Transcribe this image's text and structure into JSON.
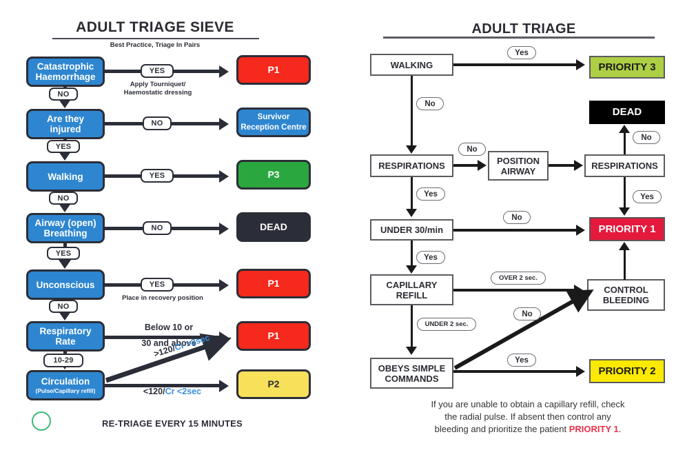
{
  "left_panel": {
    "title": "ADULT TRIAGE SIEVE",
    "subtitle": "Best Practice, Triage In Pairs",
    "questions": [
      {
        "label": "Catastrophic",
        "label2": "Haemorrhage",
        "sub": ""
      },
      {
        "label": "Are they",
        "label2": "injured",
        "sub": ""
      },
      {
        "label": "Walking",
        "label2": "",
        "sub": ""
      },
      {
        "label": "Airway (open)",
        "label2": "Breathing",
        "sub": ""
      },
      {
        "label": "Unconscious",
        "label2": "",
        "sub": ""
      },
      {
        "label": "Respiratory",
        "label2": "Rate",
        "sub": ""
      },
      {
        "label": "Circulation",
        "label2": "",
        "sub": "(Pulse/Capillary refill)"
      }
    ],
    "down_labels": [
      "NO",
      "YES",
      "NO",
      "YES",
      "NO",
      "10-29"
    ],
    "branch_labels": [
      "YES",
      "NO",
      "YES",
      "NO",
      "YES"
    ],
    "notes": [
      {
        "line1": "Apply Tourniquet/",
        "line2": "Haemostatic dressing"
      },
      {
        "line1": "Place in recovery position",
        "line2": ""
      }
    ],
    "resp_rate_label": {
      "line1": "Below 10 or",
      "line2": "30 and above"
    },
    "circulation_labels": {
      "upper_pre": ">120/",
      "upper_cr": "Cr",
      "upper_post": ">2sec",
      "lower_pre": "<120/",
      "lower_cr": "Cr",
      "lower_post": "<2sec"
    },
    "outcomes": [
      {
        "text": "P1",
        "text2": "",
        "color": "#f5291c",
        "text_color": "#ffffff"
      },
      {
        "text": "Survivor",
        "text2": "Reception Centre",
        "color": "#2e86d0",
        "text_color": "#ffffff"
      },
      {
        "text": "P3",
        "text2": "",
        "color": "#2aa83f",
        "text_color": "#ffffff"
      },
      {
        "text": "DEAD",
        "text2": "",
        "color": "#2b2e38",
        "text_color": "#ffffff"
      },
      {
        "text": "P1",
        "text2": "",
        "color": "#f5291c",
        "text_color": "#ffffff"
      },
      {
        "text": "P1",
        "text2": "",
        "color": "#f5291c",
        "text_color": "#ffffff"
      },
      {
        "text": "P2",
        "text2": "",
        "color": "#f7e05a",
        "text_color": "#2b2e38"
      }
    ],
    "footer": "RE-TRIAGE EVERY 15 MINUTES",
    "footer_circle_color": "#3cb878"
  },
  "right_panel": {
    "title": "ADULT TRIAGE",
    "boxes": {
      "walking": "WALKING",
      "respirations_left": "RESPIRATIONS",
      "position_airway_1": "POSITION",
      "position_airway_2": "AIRWAY",
      "respirations_right": "RESPIRATIONS",
      "under_30": "UNDER 30/min",
      "capillary_1": "CAPILLARY",
      "capillary_2": "REFILL",
      "obeys_1": "OBEYS SIMPLE",
      "obeys_2": "COMMANDS",
      "control_1": "CONTROL",
      "control_2": "BLEEDING"
    },
    "outcomes": {
      "priority3": {
        "text": "PRIORITY 3",
        "color": "#adcf44",
        "text_color": "#1a1a1a"
      },
      "dead": {
        "text": "DEAD",
        "color": "#000000",
        "text_color": "#ffffff"
      },
      "priority1": {
        "text": "PRIORITY 1",
        "color": "#e4193c",
        "text_color": "#ffffff"
      },
      "priority2": {
        "text": "PRIORITY 2",
        "color": "#fbe900",
        "text_color": "#1a1a1a"
      }
    },
    "edge_labels": {
      "walking_yes": "Yes",
      "walking_no": "No",
      "resp_no": "No",
      "resp_yes": "Yes",
      "resp_right_no": "No",
      "resp_right_yes": "Yes",
      "under30_no": "No",
      "under30_yes": "Yes",
      "capillary_over": "OVER 2 sec.",
      "capillary_under": "UNDER 2 sec.",
      "obeys_no": "No",
      "obeys_yes": "Yes"
    },
    "footnote": {
      "line1": "If you are unable to obtain a capillary refill, check",
      "line2": "the radial pulse. If absent then control any",
      "line3_pre": "bleeding and prioritize the patient ",
      "line3_priority": "PRIORITY 1",
      "line3_post": "."
    }
  }
}
